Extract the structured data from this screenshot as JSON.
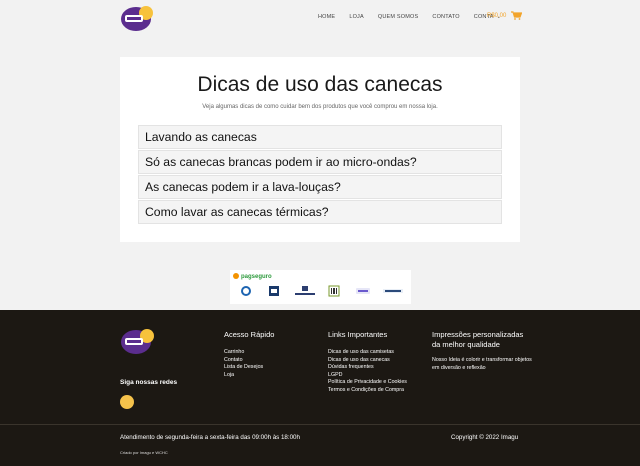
{
  "header": {
    "nav": [
      "Home",
      "Loja",
      "Quem Somos",
      "Contato",
      "Conta"
    ],
    "cart_total": "R$0,00"
  },
  "main": {
    "title": "Dicas de uso das canecas",
    "subtitle": "Veja algumas dicas de como cuidar bem dos produtos que você comprou em nossa loja.",
    "accordion": [
      "Lavando as canecas",
      "Só as canecas brancas podem ir ao micro-ondas?",
      "As canecas podem ir a lava-louças?",
      "Como lavar as canecas térmicas?"
    ]
  },
  "payment": {
    "brand": "pagseguro"
  },
  "footer": {
    "follow": "Siga nossas redes",
    "col1": {
      "title": "Acesso Rápido",
      "links": [
        "Carrinho",
        "Contato",
        "Lista de Desejos",
        "Loja"
      ]
    },
    "col2": {
      "title": "Links Importantes",
      "links": [
        "Dicas de uso das camisetas",
        "Dicas de uso das canecas",
        "Dúvidas frequentes",
        "LGPD",
        "Política de Privacidade e Cookies",
        "Termos e Condições de Compra"
      ]
    },
    "col3": {
      "title": "Impressões personalizadas da melhor qualidade",
      "text": "Nosso Ideia é colorir e transformar objetos em diversão e reflexão"
    },
    "hours": "Atendimento de segunda-feira a sexta-feira das 09:00h às 18:00h",
    "copyright": "Copyright © 2022 Imagu",
    "credit": "Criado por Imagu e WCHC"
  },
  "colors": {
    "accent": "#f2a42b",
    "footer_bg": "#1c1813",
    "logo_purple": "#5b2d8e"
  },
  "icons": [
    "logo",
    "chevron-down-icon",
    "cart-icon",
    "social-icon"
  ]
}
